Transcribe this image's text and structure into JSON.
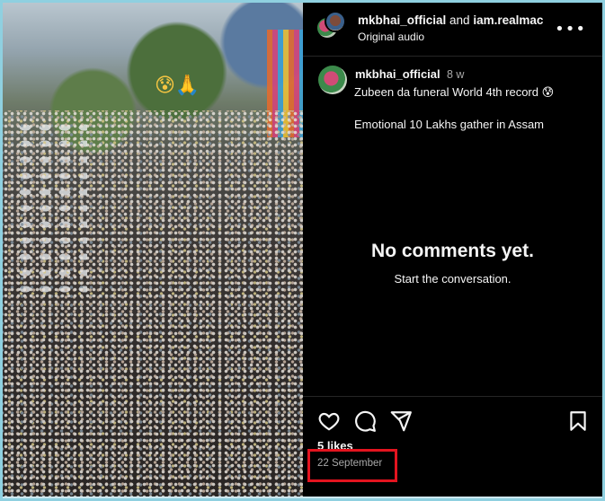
{
  "video": {
    "overlay_emoji": "😰🙏"
  },
  "header": {
    "author": "mkbhai_official",
    "connector": " and ",
    "collaborator": "iam.realmac",
    "audio_label": "Original audio",
    "more_icon": "more-horizontal-icon"
  },
  "caption": {
    "username": "mkbhai_official",
    "time_ago": "8 w",
    "line1": "Zubeen da funeral World 4th record 😰",
    "line2": "Emotional 10 Lakhs gather in Assam"
  },
  "comments": {
    "empty_title": "No comments yet.",
    "empty_subtitle": "Start the conversation."
  },
  "actions": {
    "like_icon": "heart-icon",
    "comment_icon": "comment-icon",
    "share_icon": "send-icon",
    "save_icon": "bookmark-icon"
  },
  "stats": {
    "likes": "5 likes",
    "date": "22 September"
  },
  "colors": {
    "panel_bg": "#000000",
    "highlight": "#e3141f",
    "frame": "#8fd0e0"
  }
}
